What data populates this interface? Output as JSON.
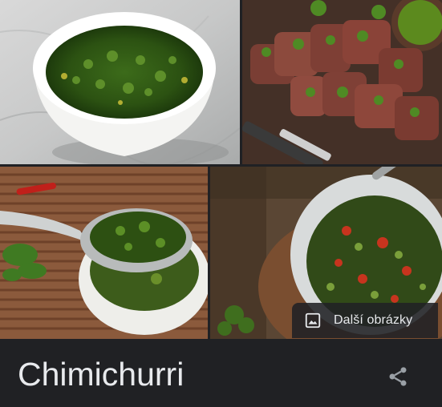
{
  "knowledge_panel": {
    "title": "Chimichurri",
    "images": [
      {
        "subject": "chimichurri sauce in white bowl on marble"
      },
      {
        "subject": "sliced steak with chimichurri on wooden board"
      },
      {
        "subject": "spoon of chimichurri over bowl on bamboo mat"
      },
      {
        "subject": "chimichurri with tomatoes in bowl with spoon"
      }
    ],
    "more_images_label": "Další obrázky",
    "more_images_icon": "image-icon",
    "share_icon": "share-icon"
  },
  "colors": {
    "background": "#202124",
    "text": "#e8eaed",
    "icon": "#9aa0a6"
  }
}
